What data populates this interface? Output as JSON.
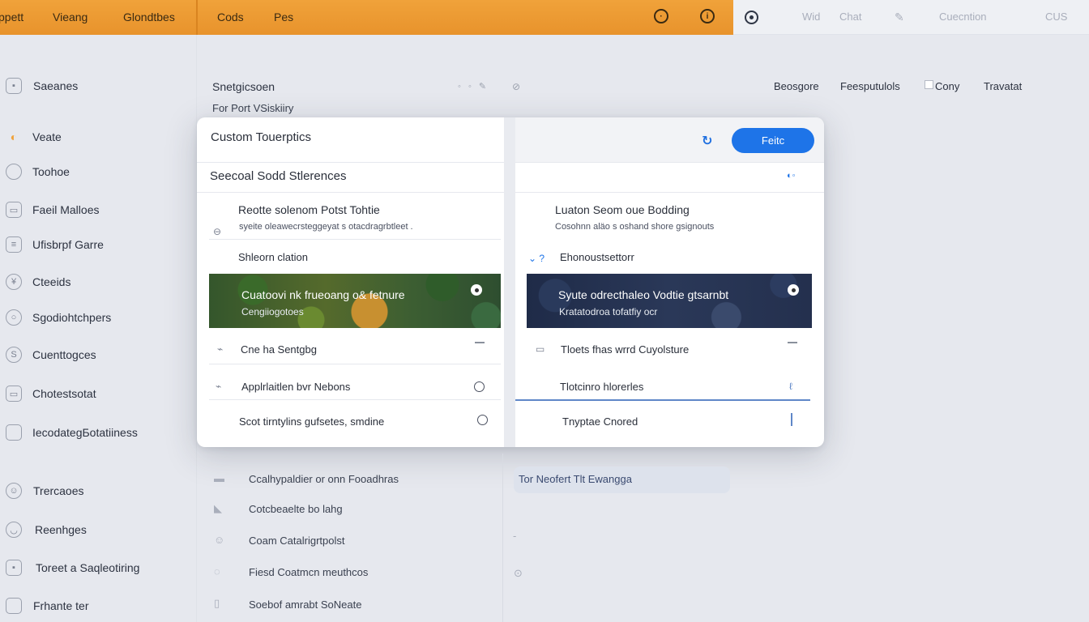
{
  "topbar": {
    "items": [
      "ppett",
      "Vieang",
      "Glondtbes",
      "Cods",
      "Pes"
    ],
    "right_items": [
      "Wid",
      "Chat",
      "Cuecntion",
      "CUS"
    ],
    "accent": "#e8932c"
  },
  "sidebar": {
    "items": [
      {
        "label": "Saeanes",
        "icon": "square-icon"
      },
      {
        "label": "Veate",
        "icon": "bulb-icon"
      },
      {
        "label": "Toohoe",
        "icon": "square-icon"
      },
      {
        "label": "Faeil Malloes",
        "icon": "square-icon"
      },
      {
        "label": "Ufisbrpf Garre",
        "icon": "sliders-icon"
      },
      {
        "label": "Cteeids",
        "icon": "circle-icon"
      },
      {
        "label": "Sgodiohtchpers",
        "icon": "bulb-icon"
      },
      {
        "label": "Cuenttogces",
        "icon": "circle-icon"
      },
      {
        "label": "Chotestsotat",
        "icon": "square-icon"
      },
      {
        "label": "IecodategБotatiiness",
        "icon": "square-icon"
      },
      {
        "label": "Trercaoes",
        "icon": "people-icon"
      },
      {
        "label": "Reenhges",
        "icon": "circle-icon"
      },
      {
        "label": "Toreet a Saqleotiring",
        "icon": "square-icon"
      },
      {
        "label": "Frhante ter",
        "icon": "square-icon"
      }
    ]
  },
  "header": {
    "line1": "Snetgicsoen",
    "line2": "For Port  VSiskiiry",
    "nav": [
      "Beosgore",
      "Feesputulols",
      "Cony",
      "Travatat"
    ]
  },
  "modal": {
    "title": "Custom Touerptics",
    "primary_button": "Feitc",
    "subtitle": "Seecoal Sodd Stlerences",
    "left": {
      "heading": "Reotte solenom Potst Tohtie",
      "desc": "syeite oleawecrsteggeyat s otacdragrbtleet .",
      "section": "Shleorn clation",
      "banner_title": "Cuatoovi nk frueoang o& fetnure",
      "banner_sub": "Cengiiogotoes",
      "rows": [
        "Cne ha Sentgbg",
        "Applrlaitlen bvr Nebons",
        "Scot tirntylins gufsetes, smdine"
      ]
    },
    "right": {
      "heading": "Luaton Seom oue Bodding",
      "desc": "Cosohnn aläo s oshand shore gsignouts",
      "section": "Ehonoustsettorr",
      "banner_title": "Syute odrecthaleo Vodtie gtsarnbt",
      "banner_sub": "Kratatodroa tofatfiy ocr",
      "rows": [
        "Tloets fhas wrrd Cuyolsture",
        "Tlotcinro hlorerles",
        "Tnyptae Cnored"
      ]
    }
  },
  "below": {
    "left_items": [
      "Ccalhypaldier or onn  Fooadhras",
      "Cotcbeaelte bo lahg",
      "Coam Catalrigrtpolst",
      "Fiesd  Coatmcn meuthcos",
      "Soebof amrabt SoNeate"
    ],
    "pill": "Tor  Neofert   Tlt Ewangga"
  }
}
